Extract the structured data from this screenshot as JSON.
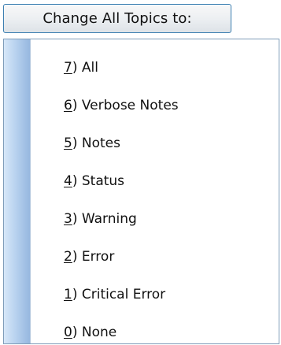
{
  "button": {
    "label": "Change All Topics to:"
  },
  "menu": {
    "items": [
      {
        "key": "7",
        "text": ") All"
      },
      {
        "key": "6",
        "text": ") Verbose Notes"
      },
      {
        "key": "5",
        "text": ") Notes"
      },
      {
        "key": "4",
        "text": ") Status"
      },
      {
        "key": "3",
        "text": ") Warning"
      },
      {
        "key": "2",
        "text": ") Error"
      },
      {
        "key": "1",
        "text": ") Critical Error"
      },
      {
        "key": "0",
        "text": ") None"
      }
    ]
  }
}
